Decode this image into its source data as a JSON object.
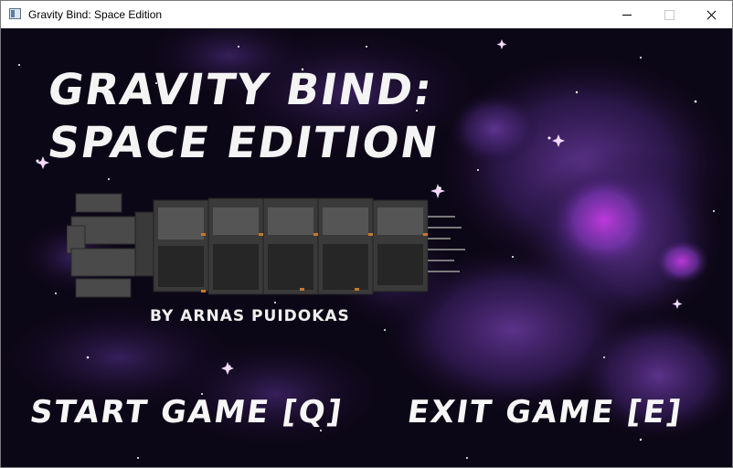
{
  "window": {
    "title": "Gravity Bind: Space Edition"
  },
  "game": {
    "title_line1": "GRAVITY BIND:",
    "title_line2": "SPACE EDITION",
    "byline": "BY ARNAS PUIDOKAS",
    "menu": {
      "start_label": "START GAME [Q]",
      "exit_label": "EXIT GAME [E]"
    }
  },
  "colors": {
    "space_background": "#0c0716",
    "nebula_purple": "#5a2e8e",
    "nebula_magenta": "#b433d6",
    "text": "#f4f4f4",
    "ship_hull": "#3f3f3f"
  },
  "icons": [
    "app-window-icon",
    "minimize-icon",
    "maximize-icon",
    "close-icon"
  ]
}
